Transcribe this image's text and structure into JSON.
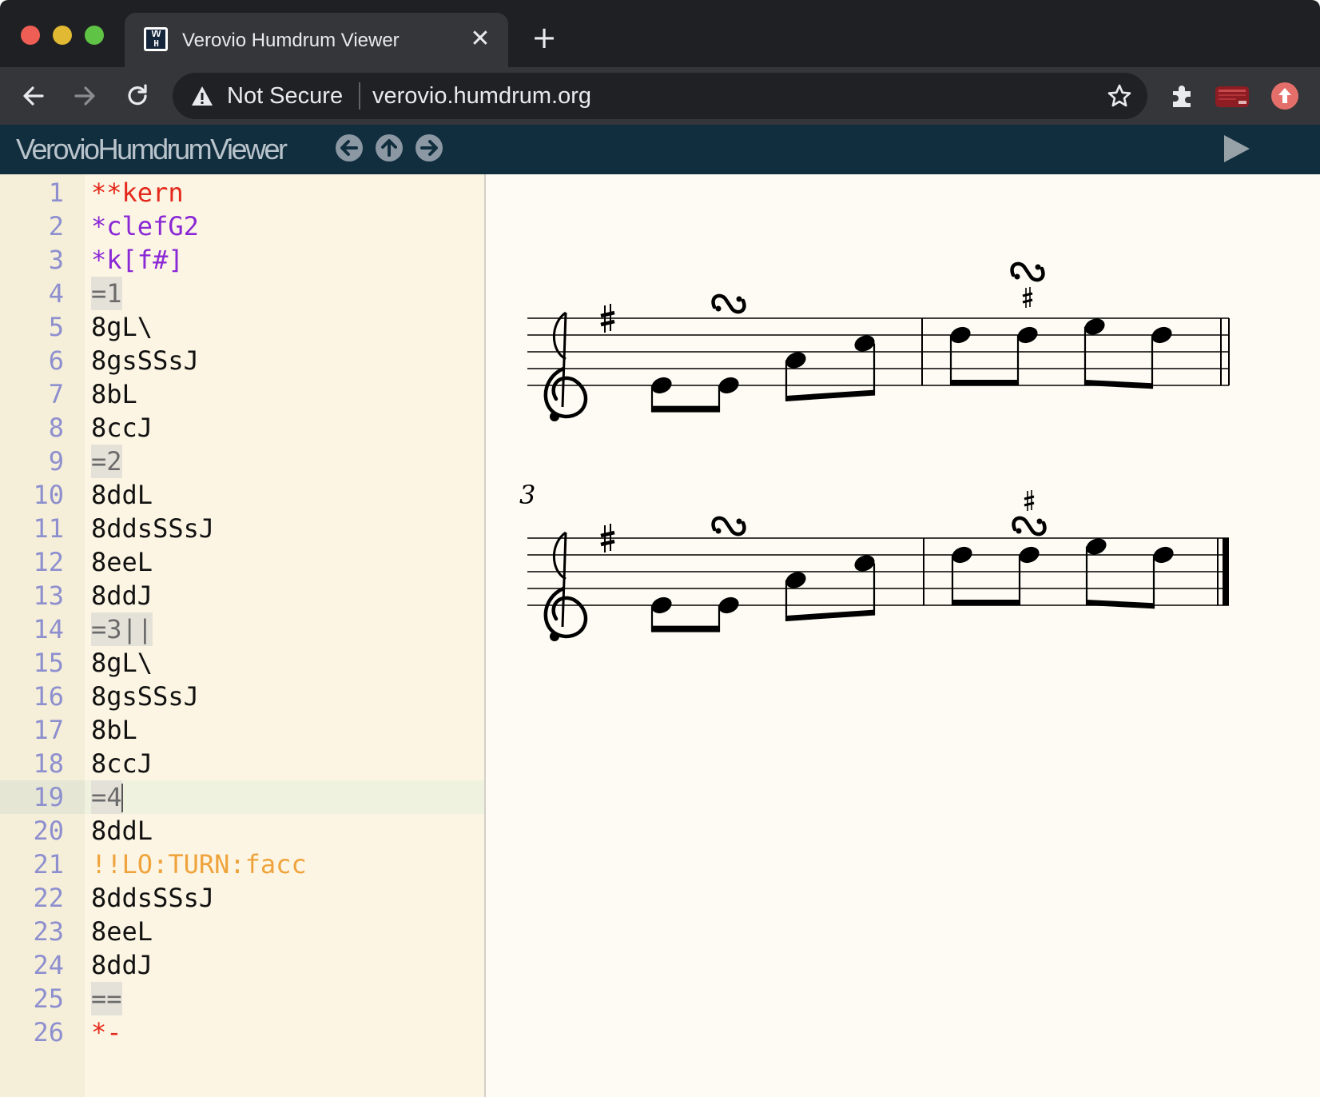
{
  "browser": {
    "tab": {
      "title": "Verovio Humdrum Viewer",
      "favicon": "vhv-logo-icon",
      "close_icon": "✕"
    },
    "new_tab_icon": "+",
    "address_bar": {
      "security_label": "Not Secure",
      "url": "verovio.humdrum.org"
    }
  },
  "app": {
    "title": "VerovioHumdrumViewer"
  },
  "editor": {
    "cursor_line": 19,
    "lines": [
      {
        "n": "1",
        "text": "**kern",
        "kind": "excl"
      },
      {
        "n": "2",
        "text": "*clefG2",
        "kind": "interp"
      },
      {
        "n": "3",
        "text": "*k[f#]",
        "kind": "interp"
      },
      {
        "n": "4",
        "text": "=1",
        "kind": "bar"
      },
      {
        "n": "5",
        "text": "8gL\\",
        "kind": "data"
      },
      {
        "n": "6",
        "text": "8gsSSsJ",
        "kind": "data"
      },
      {
        "n": "7",
        "text": "8bL",
        "kind": "data"
      },
      {
        "n": "8",
        "text": "8ccJ",
        "kind": "data"
      },
      {
        "n": "9",
        "text": "=2",
        "kind": "bar"
      },
      {
        "n": "10",
        "text": "8ddL",
        "kind": "data"
      },
      {
        "n": "11",
        "text": "8ddsSSsJ",
        "kind": "data"
      },
      {
        "n": "12",
        "text": "8eeL",
        "kind": "data"
      },
      {
        "n": "13",
        "text": "8ddJ",
        "kind": "data"
      },
      {
        "n": "14",
        "text": "=3||",
        "kind": "bar"
      },
      {
        "n": "15",
        "text": "8gL\\",
        "kind": "data"
      },
      {
        "n": "16",
        "text": "8gsSSsJ",
        "kind": "data"
      },
      {
        "n": "17",
        "text": "8bL",
        "kind": "data"
      },
      {
        "n": "18",
        "text": "8ccJ",
        "kind": "data"
      },
      {
        "n": "19",
        "text": "=4",
        "kind": "bar"
      },
      {
        "n": "20",
        "text": "8ddL",
        "kind": "data"
      },
      {
        "n": "21",
        "text": "!!LO:TURN:facc",
        "kind": "comment"
      },
      {
        "n": "22",
        "text": "8ddsSSsJ",
        "kind": "data"
      },
      {
        "n": "23",
        "text": "8eeL",
        "kind": "data"
      },
      {
        "n": "24",
        "text": "8ddJ",
        "kind": "data"
      },
      {
        "n": "25",
        "text": "==",
        "kind": "bar"
      },
      {
        "n": "26",
        "text": "*-",
        "kind": "excl"
      }
    ]
  },
  "score": {
    "clef": "treble",
    "key_signature": "F#",
    "measure_number": "3",
    "systems": [
      {
        "measures": [
          "1",
          "2"
        ],
        "end_barline": "double",
        "ornaments": [
          "turn",
          "turn-with-sharp-above"
        ]
      },
      {
        "measures": [
          "3",
          "4"
        ],
        "end_barline": "final",
        "ornaments": [
          "turn",
          "turn-with-sharp-above"
        ]
      }
    ]
  },
  "colors": {
    "tabstrip": "#1f2023",
    "toolbar": "#35363a",
    "app_header": "#112e3e",
    "editor_bg": "#fdf5e3",
    "gutter_bg": "#f5eed9",
    "line_number": "#8d8fcf",
    "exclusive_interpretation": "#e4281b",
    "interpretation": "#8a27d6",
    "comment": "#efa33c"
  }
}
